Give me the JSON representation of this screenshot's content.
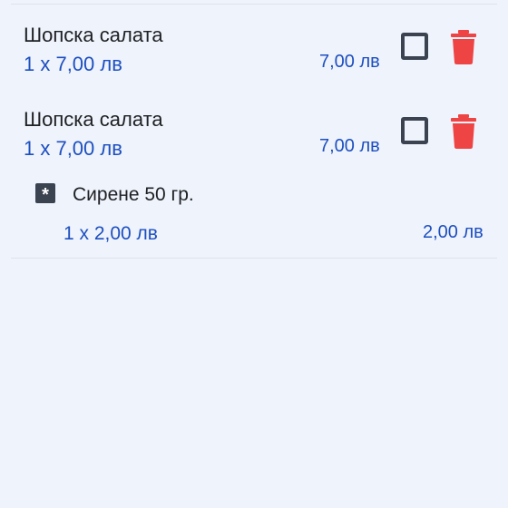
{
  "colors": {
    "background": "#eef3fc",
    "price_text": "#1d4fc0",
    "delete_icon": "#ef4444",
    "checkbox_border": "#3b4350"
  },
  "items": [
    {
      "name": "Шопска салата",
      "qty_price": "1 x 7,00  лв",
      "total": "7,00  лв",
      "checked": false,
      "checkbox_icon": "checkbox-icon",
      "delete_icon": "trash-icon"
    },
    {
      "name": "Шопска салата",
      "qty_price": "1 x 7,00  лв",
      "total": "7,00  лв",
      "checked": false,
      "checkbox_icon": "checkbox-icon",
      "delete_icon": "trash-icon",
      "modifiers": [
        {
          "icon": "asterisk-icon",
          "name": "Сирене 50 гр.",
          "qty_price": "1 x 2,00  лв",
          "total": "2,00  лв"
        }
      ]
    }
  ]
}
